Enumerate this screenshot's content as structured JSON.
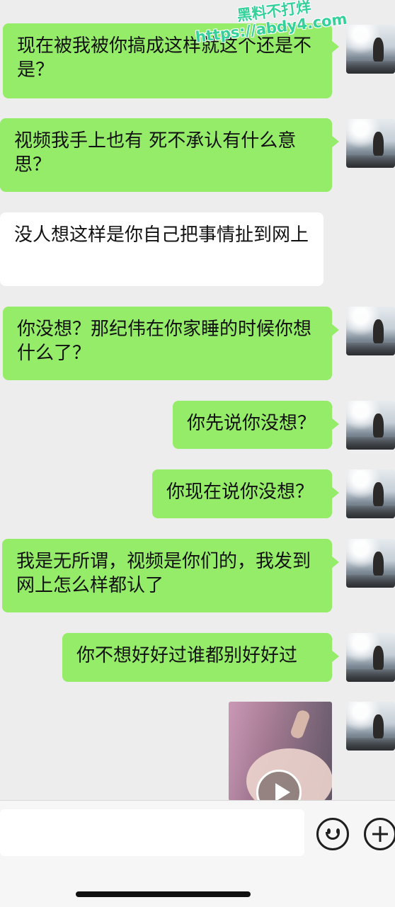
{
  "watermark": {
    "line1": "黑料不打烊",
    "line2": "https://abdy4.com"
  },
  "messages": [
    {
      "from": "me",
      "text": "现在被我被你搞成这样就这个还是不是？"
    },
    {
      "from": "me",
      "text": "视频我手上也有 死不承认有什么意思？"
    },
    {
      "from": "other",
      "text": "没人想这样是你自己把事情扯到网上"
    },
    {
      "from": "me",
      "text": "你没想？那纪伟在你家睡的时候你想什么了？"
    },
    {
      "from": "me",
      "text": "你先说你没想？"
    },
    {
      "from": "me",
      "text": "你现在说你没想？"
    },
    {
      "from": "me",
      "text": "我是无所谓，视频是你们的，我发到网上怎么样都认了"
    },
    {
      "from": "me",
      "text": "你不想好好过谁都别好好过"
    },
    {
      "from": "me",
      "type": "video"
    }
  ],
  "input_bar": {
    "value": "",
    "placeholder": ""
  }
}
